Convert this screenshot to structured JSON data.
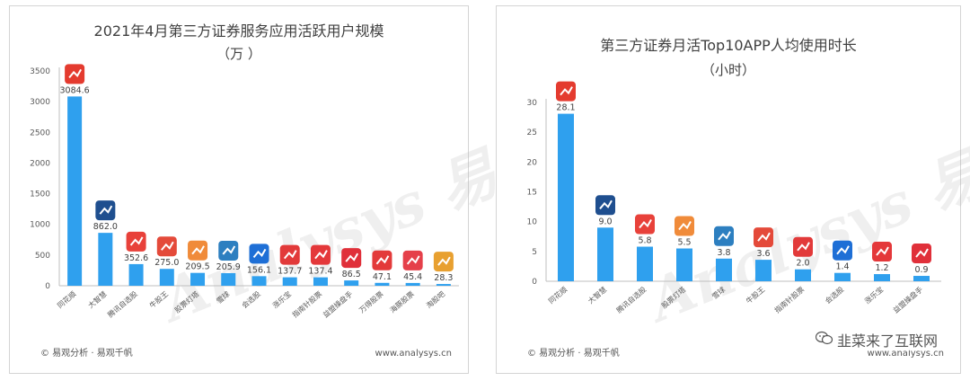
{
  "left": {
    "title": "2021年4月第三方证券服务应用活跃用户规模",
    "unit": "（万 ）",
    "footer_brand": "© 易观分析 · 易观千帆",
    "footer_site": "www.analysys.cn",
    "icon_colors": [
      "#e43b2f",
      "#1f4f8f",
      "#e8413a",
      "#e44a3a",
      "#f08b3a",
      "#2d7fc0",
      "#1e6fd6",
      "#e23a3a",
      "#e4383a",
      "#e0303a",
      "#e33a3a",
      "#e5404a",
      "#e8a030"
    ]
  },
  "right": {
    "title": "第三方证券月活Top10APP人均使用时长",
    "unit": "（小时）",
    "footer_brand": "© 易观分析 · 易观千帆",
    "footer_site": "www.analysys.cn",
    "icon_colors": [
      "#e43b2f",
      "#1f4f8f",
      "#e8413a",
      "#f08b3a",
      "#2d7fc0",
      "#e44a3a",
      "#e23a3a",
      "#1e6fd6",
      "#e4383a",
      "#e0303a"
    ]
  },
  "wechat_caption": "韭菜来了互联网",
  "chart_data": [
    {
      "type": "bar",
      "title": "2021年4月第三方证券服务应用活跃用户规模",
      "subtitle": "（万 ）",
      "categories": [
        "同花顺",
        "大智慧",
        "腾讯自选股",
        "牛股王",
        "股票灯塔",
        "雪球",
        "会选股",
        "涨乐宝",
        "指南针股票",
        "益盟操盘手",
        "万得股票",
        "海豚股票",
        "淘股吧"
      ],
      "values": [
        3084.6,
        862.0,
        352.6,
        275.0,
        209.5,
        205.9,
        156.1,
        137.7,
        137.4,
        86.5,
        47.1,
        45.4,
        28.3
      ],
      "value_labels": [
        "3084.6",
        "862.0",
        "352.6",
        "275.0",
        "209.5",
        "205.9",
        "156.1",
        "137.7",
        "137.4",
        "86.5",
        "47.1",
        "45.4",
        "28.3"
      ],
      "yticks": [
        0,
        500,
        1000,
        1500,
        2000,
        2500,
        3000,
        3500
      ],
      "ylim": [
        0,
        3500
      ],
      "color": "#2fa0ee",
      "grid": false
    },
    {
      "type": "bar",
      "title": "第三方证券月活Top10APP人均使用时长",
      "subtitle": "（小时）",
      "categories": [
        "同花顺",
        "大智慧",
        "腾讯自选股",
        "股票灯塔",
        "雪球",
        "牛股王",
        "指南针股票",
        "会选股",
        "涨乐宝",
        "益盟操盘手"
      ],
      "values": [
        28.1,
        9.0,
        5.8,
        5.5,
        3.8,
        3.6,
        2.0,
        1.4,
        1.2,
        0.9
      ],
      "value_labels": [
        "28.1",
        "9.0",
        "5.8",
        "5.5",
        "3.8",
        "3.6",
        "2.0",
        "1.4",
        "1.2",
        "0.9"
      ],
      "yticks": [
        0,
        5,
        10,
        15,
        20,
        25,
        30
      ],
      "ylim": [
        0,
        30
      ],
      "color": "#2fa0ee",
      "grid": false
    }
  ]
}
